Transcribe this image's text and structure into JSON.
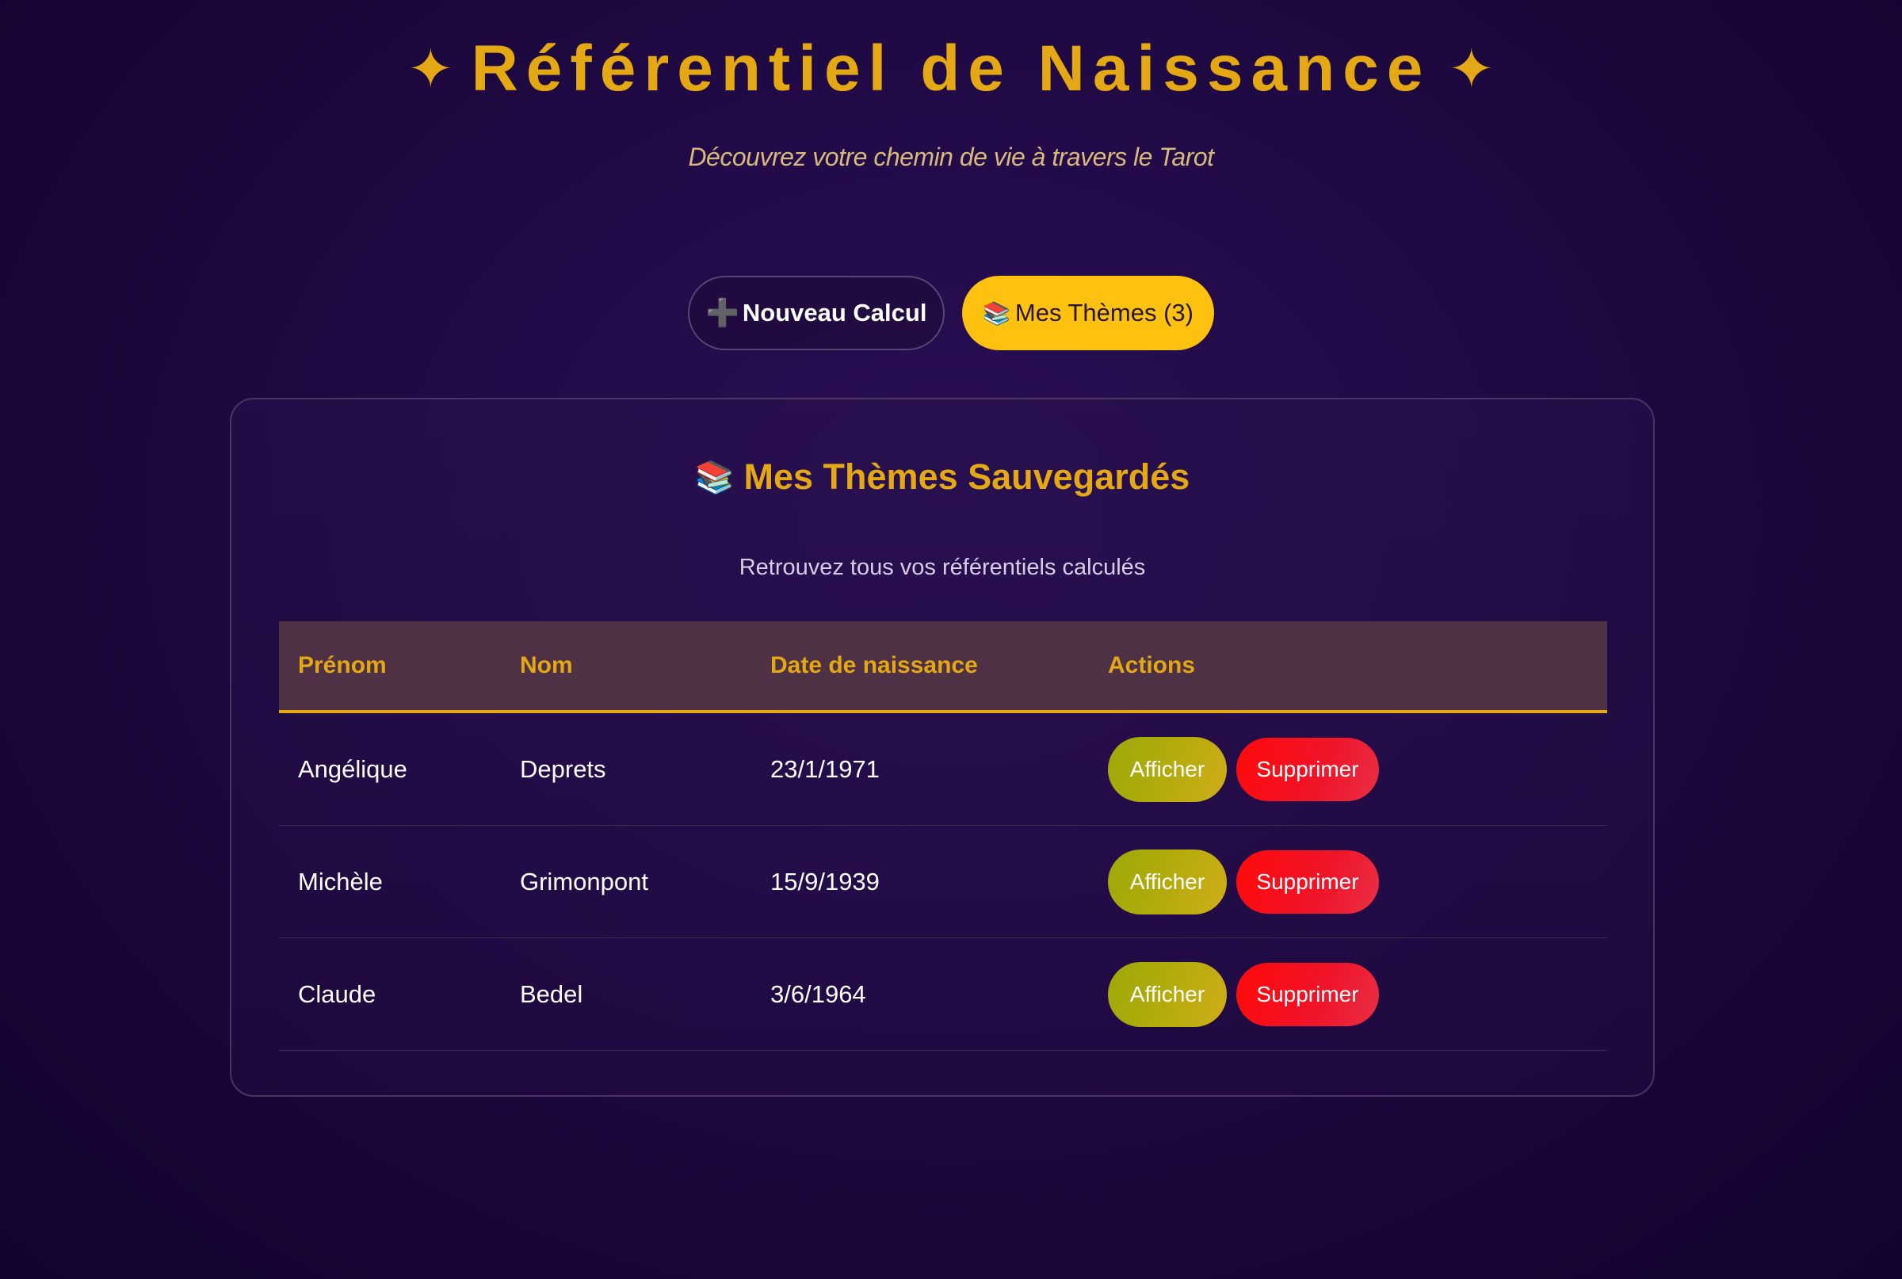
{
  "header": {
    "star_left": "✦",
    "title": "Référentiel de Naissance",
    "star_right": "✦",
    "subtitle": "Découvrez votre chemin de vie à travers le Tarot"
  },
  "tabs": {
    "new_calc": {
      "icon": "➕",
      "label": "Nouveau Calcul"
    },
    "themes": {
      "icon": "📚",
      "label": "Mes Thèmes (3)"
    }
  },
  "panel": {
    "icon": "📚",
    "title": "Mes Thèmes Sauvegardés",
    "subtitle": "Retrouvez tous vos référentiels calculés"
  },
  "table": {
    "headers": [
      "Prénom",
      "Nom",
      "Date de naissance",
      "Actions"
    ],
    "rows": [
      {
        "prenom": "Angélique",
        "nom": "Deprets",
        "date": "23/1/1971"
      },
      {
        "prenom": "Michèle",
        "nom": "Grimonpont",
        "date": "15/9/1939"
      },
      {
        "prenom": "Claude",
        "nom": "Bedel",
        "date": "3/6/1964"
      }
    ],
    "view_label": "Afficher",
    "delete_label": "Supprimer"
  },
  "colors": {
    "accent_gold": "#e4a814",
    "active_tab": "#fdc10f",
    "delete_red": "#ff0a0a",
    "view_olive": "#9ba90a"
  }
}
